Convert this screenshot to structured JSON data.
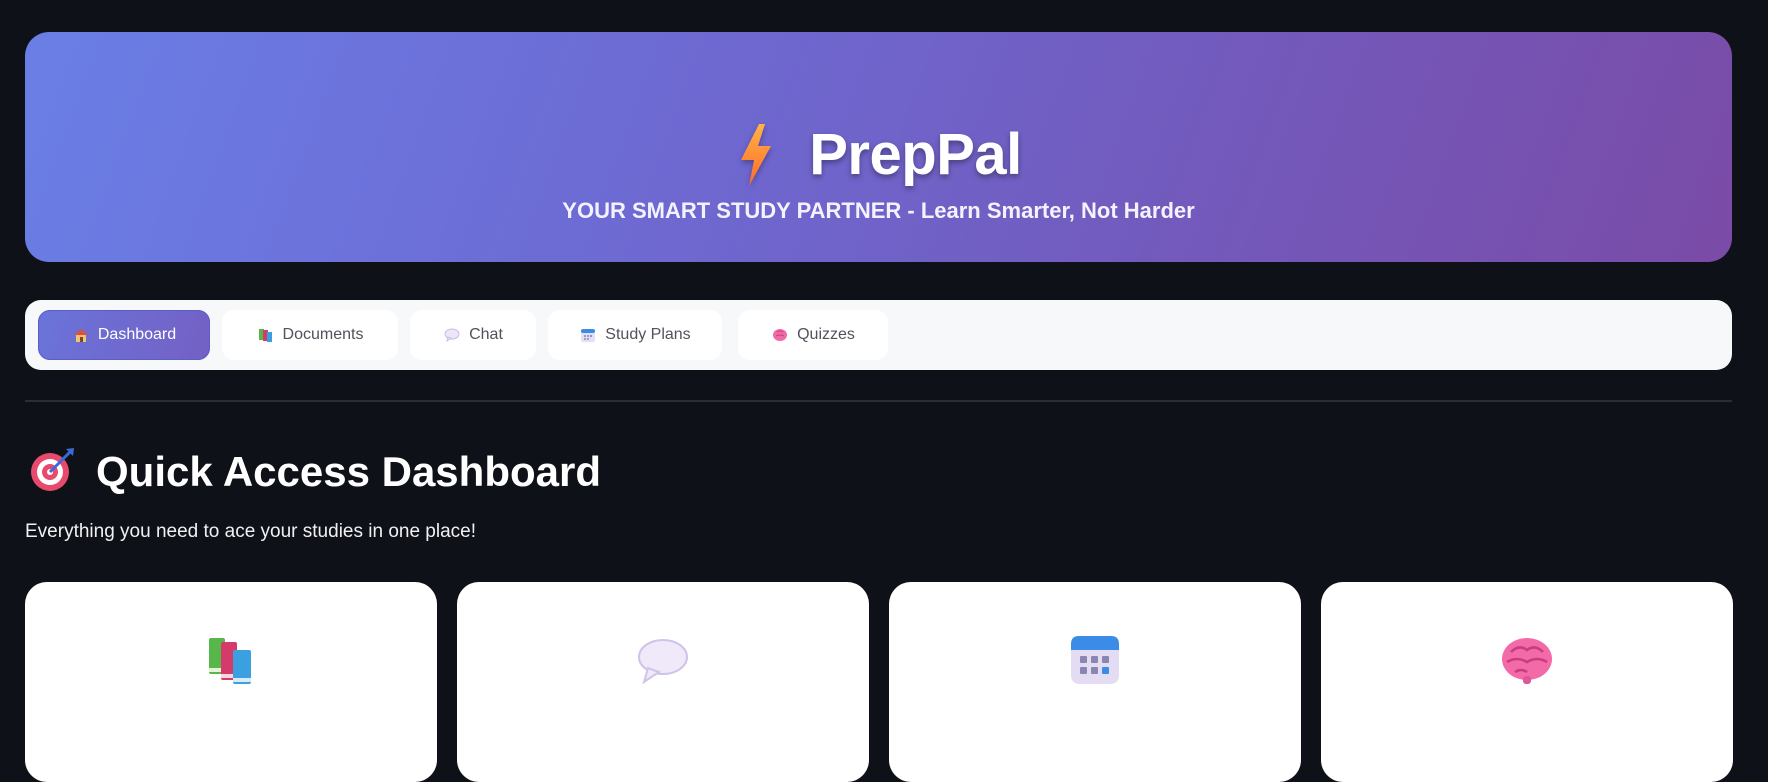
{
  "hero": {
    "title": "PrepPal",
    "subtitle": "YOUR SMART STUDY PARTNER - Learn Smarter, Not Harder",
    "icon": "lightning-bolt-icon"
  },
  "tabs": [
    {
      "label": "Dashboard",
      "icon": "house-icon",
      "active": true
    },
    {
      "label": "Documents",
      "icon": "books-icon",
      "active": false
    },
    {
      "label": "Chat",
      "icon": "speech-bubble-icon",
      "active": false
    },
    {
      "label": "Study Plans",
      "icon": "calendar-icon",
      "active": false
    },
    {
      "label": "Quizzes",
      "icon": "brain-icon",
      "active": false
    }
  ],
  "dashboard": {
    "title": "Quick Access Dashboard",
    "subtitle": "Everything you need to ace your studies in one place!",
    "icon": "target-icon",
    "cards": [
      {
        "icon": "books-icon"
      },
      {
        "icon": "speech-bubble-icon"
      },
      {
        "icon": "calendar-icon"
      },
      {
        "icon": "brain-icon"
      }
    ]
  },
  "colors": {
    "background": "#0f1118",
    "hero_gradient_start": "#6a7fe6",
    "hero_gradient_end": "#7a4ba7",
    "active_tab_underline": "#ea4b56"
  }
}
